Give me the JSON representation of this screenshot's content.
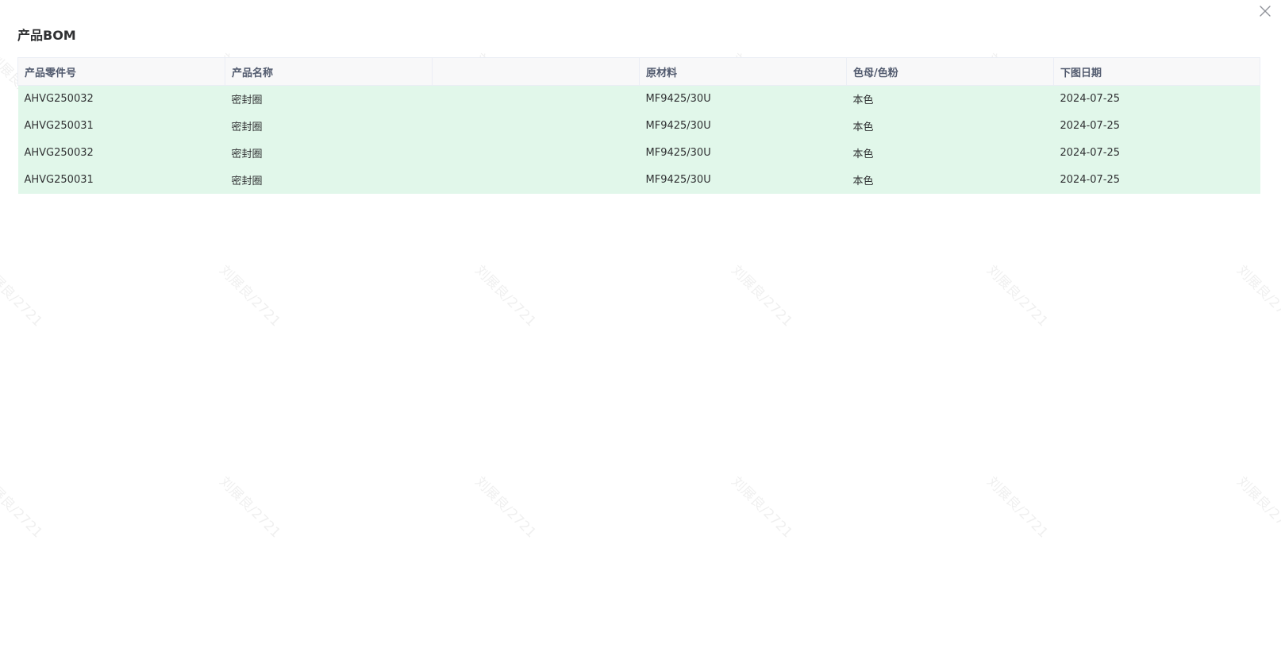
{
  "dialog": {
    "title": "产品BOM",
    "close_icon": "close-icon"
  },
  "watermark": {
    "text": "刘展良/2721"
  },
  "table": {
    "columns": [
      "产品零件号",
      "产品名称",
      "",
      "原材料",
      "色母/色粉",
      "下图日期"
    ],
    "rows": [
      [
        "AHVG250032",
        "密封圈",
        "",
        "MF9425/30U",
        "本色",
        "2024-07-25"
      ],
      [
        "AHVG250031",
        "密封圈",
        "",
        "MF9425/30U",
        "本色",
        "2024-07-25"
      ],
      [
        "AHVG250032",
        "密封圈",
        "",
        "MF9425/30U",
        "本色",
        "2024-07-25"
      ],
      [
        "AHVG250031",
        "密封圈",
        "",
        "MF9425/30U",
        "本色",
        "2024-07-25"
      ]
    ],
    "row_color": "#e1f7ea",
    "header_color": "#f8f8f9"
  }
}
